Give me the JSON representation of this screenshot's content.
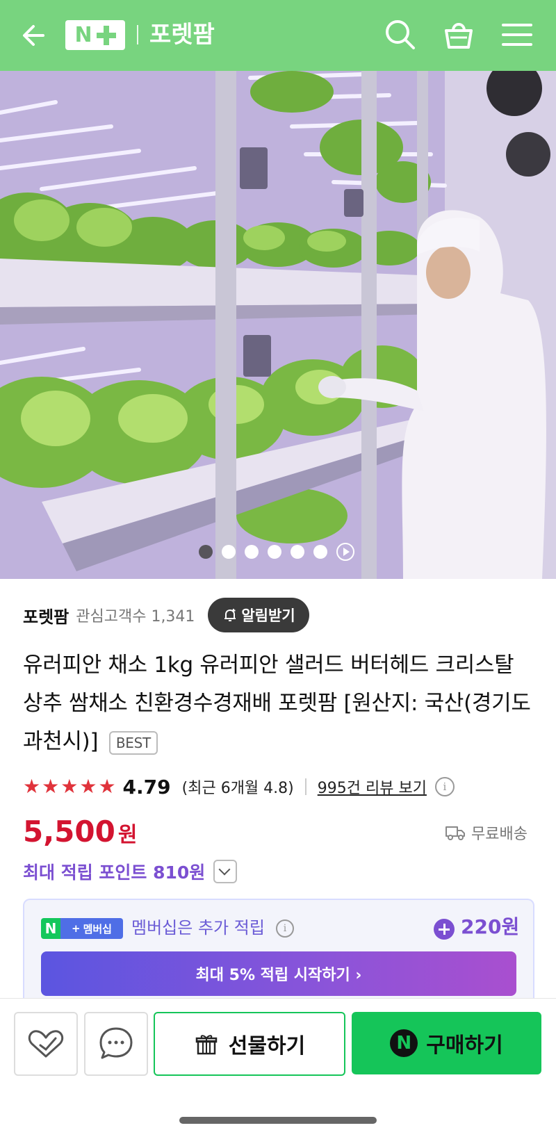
{
  "header": {
    "logo_text": "N+",
    "store_name": "포렛팜"
  },
  "gallery": {
    "total_dots": 6,
    "active_index": 0
  },
  "store": {
    "name": "포렛팜",
    "interest_label": "관심고객수 1,341",
    "alarm_button": "알림받기"
  },
  "product": {
    "title": "유러피안 채소 1kg 유러피안 샐러드 버터헤드 크리스탈 상추 쌈채소 친환경수경재배 포렛팜 [원산지: 국산(경기도 과천시)]",
    "badge": "BEST"
  },
  "rating": {
    "stars": 5,
    "score": "4.79",
    "recent": "(최근 6개월 4.8)",
    "review_link": "995건 리뷰 보기"
  },
  "price": {
    "amount": "5,500",
    "unit": "원",
    "shipping": "무료배송",
    "points_label": "최대 적립 포인트 810원"
  },
  "membership": {
    "badge_n": "N",
    "badge_plus": "+",
    "badge_text": "멤버십",
    "text": "멤버십은 추가 적립",
    "amount": "220원",
    "start_button": "최대 5% 적립 시작하기 ›"
  },
  "bottom_bar": {
    "gift_label": "선물하기",
    "buy_label": "구매하기",
    "buy_n": "N"
  },
  "colors": {
    "header_green": "#78d47f",
    "price_red": "#d31430",
    "points_purple": "#7b4fd1",
    "buy_green": "#15c559"
  }
}
